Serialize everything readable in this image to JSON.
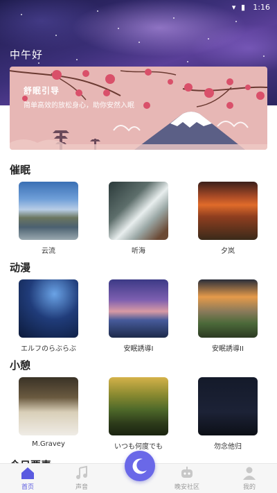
{
  "status_bar": {
    "time": "1:16"
  },
  "header": {
    "greeting": "中午好"
  },
  "banner": {
    "title": "舒眠引导",
    "subtitle": "简单高效的放松身心，助你安然入眠"
  },
  "sections": [
    {
      "title": "催眠",
      "items": [
        {
          "label": "云流"
        },
        {
          "label": "听海"
        },
        {
          "label": "夕岚"
        }
      ]
    },
    {
      "title": "动漫",
      "items": [
        {
          "label": "エルフのらぶらぶ"
        },
        {
          "label": "安眠誘導I"
        },
        {
          "label": "安眠誘導II"
        }
      ]
    },
    {
      "title": "小憩",
      "items": [
        {
          "label": "M.Gravey"
        },
        {
          "label": "いつも何度でも"
        },
        {
          "label": "勿念他归"
        }
      ]
    }
  ],
  "next_section": {
    "title": "今日要素"
  },
  "bottom_nav": {
    "items": [
      {
        "label": "首页",
        "active": true,
        "icon": "home-icon"
      },
      {
        "label": "声音",
        "active": false,
        "icon": "music-note-icon"
      },
      {
        "label": "",
        "active": false,
        "icon": "moon-sleep-icon"
      },
      {
        "label": "晚安社区",
        "active": false,
        "icon": "community-icon"
      },
      {
        "label": "我的",
        "active": false,
        "icon": "user-icon"
      }
    ]
  },
  "colors": {
    "accent": "#5b5be0",
    "banner_bg": "#e7b7b5"
  }
}
